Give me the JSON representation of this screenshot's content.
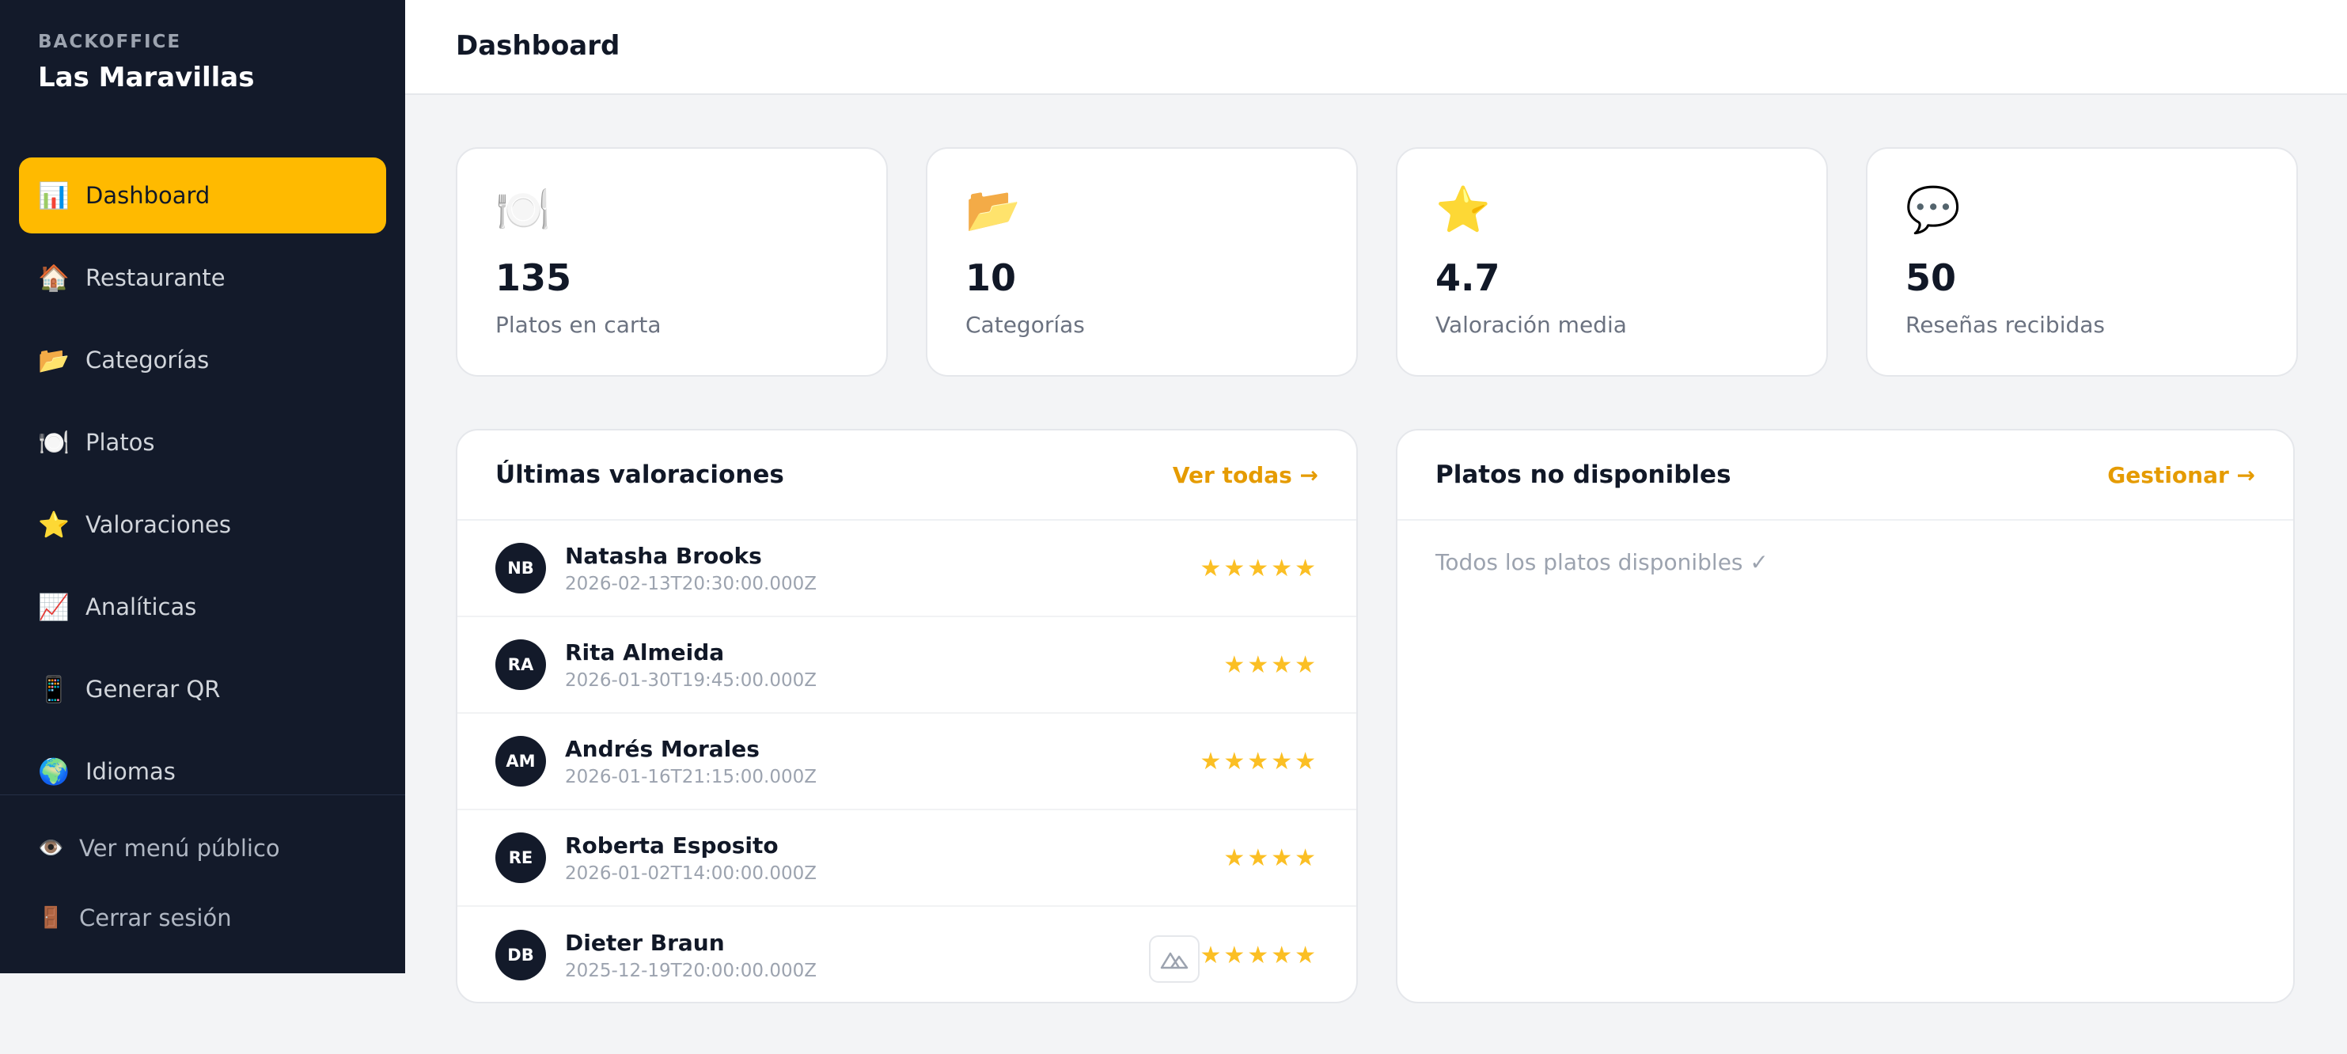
{
  "brand": {
    "kicker": "BACKOFFICE",
    "name": "Las Maravillas"
  },
  "sidebar": {
    "items": [
      {
        "icon": "📊",
        "icon_name": "bar-chart-icon",
        "label": "Dashboard",
        "active": true
      },
      {
        "icon": "🏠",
        "icon_name": "house-icon",
        "label": "Restaurante"
      },
      {
        "icon": "📂",
        "icon_name": "folder-icon",
        "label": "Categorías"
      },
      {
        "icon": "🍽️",
        "icon_name": "plate-icon",
        "label": "Platos"
      },
      {
        "icon": "⭐",
        "icon_name": "star-icon",
        "label": "Valoraciones"
      },
      {
        "icon": "📈",
        "icon_name": "trend-chart-icon",
        "label": "Analíticas"
      },
      {
        "icon": "📱",
        "icon_name": "phone-icon",
        "label": "Generar QR"
      },
      {
        "icon": "🌍",
        "icon_name": "globe-icon",
        "label": "Idiomas"
      }
    ],
    "footer": [
      {
        "icon": "👁️",
        "icon_name": "eye-icon",
        "label": "Ver menú público"
      },
      {
        "icon": "🚪",
        "icon_name": "door-icon",
        "label": "Cerrar sesión"
      }
    ]
  },
  "header": {
    "title": "Dashboard"
  },
  "stats": [
    {
      "icon": "🍽️",
      "icon_name": "plate-icon",
      "value": "135",
      "label": "Platos en carta"
    },
    {
      "icon": "📂",
      "icon_name": "folder-icon",
      "value": "10",
      "label": "Categorías"
    },
    {
      "icon": "⭐",
      "icon_name": "star-icon",
      "value": "4.7",
      "label": "Valoración media"
    },
    {
      "icon": "💬",
      "icon_name": "speech-bubble-icon",
      "value": "50",
      "label": "Reseñas recibidas"
    }
  ],
  "reviews_panel": {
    "title": "Últimas valoraciones",
    "link": "Ver todas →",
    "rows": [
      {
        "initials": "NB",
        "name": "Natasha Brooks",
        "date": "2026-02-13T20:30:00.000Z",
        "rating": 5
      },
      {
        "initials": "RA",
        "name": "Rita Almeida",
        "date": "2026-01-30T19:45:00.000Z",
        "rating": 4
      },
      {
        "initials": "AM",
        "name": "Andrés Morales",
        "date": "2026-01-16T21:15:00.000Z",
        "rating": 5
      },
      {
        "initials": "RE",
        "name": "Roberta Esposito",
        "date": "2026-01-02T14:00:00.000Z",
        "rating": 4
      },
      {
        "initials": "DB",
        "name": "Dieter Braun",
        "date": "2025-12-19T20:00:00.000Z",
        "rating": 5
      }
    ]
  },
  "unavailable_panel": {
    "title": "Platos no disponibles",
    "link": "Gestionar →",
    "empty_text": "Todos los platos disponibles ✓"
  },
  "colors": {
    "sidebar_bg": "#131a2a",
    "accent": "#ffba00",
    "link": "#e59b00",
    "star": "#fbbf24"
  }
}
